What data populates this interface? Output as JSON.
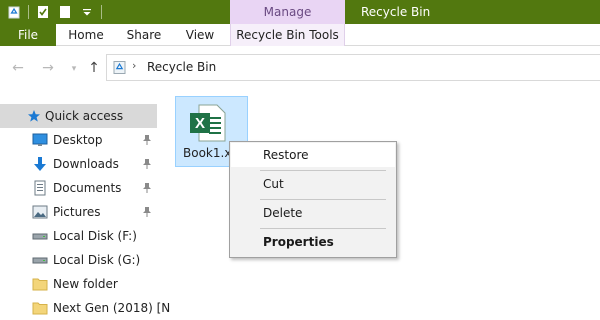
{
  "window": {
    "title": "Recycle Bin",
    "context_group": "Manage"
  },
  "ribbon": {
    "tabs": [
      "File",
      "Home",
      "Share",
      "View",
      "Recycle Bin Tools"
    ]
  },
  "address": {
    "location": "Recycle Bin",
    "separator": "›"
  },
  "nav": {
    "back_glyph": "←",
    "forward_glyph": "→",
    "recent_glyph": "▾",
    "up_glyph": "↑"
  },
  "nav_pane": {
    "items": [
      {
        "label": "Quick access",
        "icon": "star-icon"
      },
      {
        "label": "Desktop",
        "icon": "desktop-icon",
        "pinned": true
      },
      {
        "label": "Downloads",
        "icon": "download-icon",
        "pinned": true
      },
      {
        "label": "Documents",
        "icon": "documents-icon",
        "pinned": true
      },
      {
        "label": "Pictures",
        "icon": "pictures-icon",
        "pinned": true
      },
      {
        "label": "Local Disk (F:)",
        "icon": "drive-icon"
      },
      {
        "label": "Local Disk (G:)",
        "icon": "drive-icon"
      },
      {
        "label": "New folder",
        "icon": "folder-icon"
      },
      {
        "label": "Next Gen (2018) [N",
        "icon": "folder-icon"
      }
    ]
  },
  "files": [
    {
      "name": "Book1.xl",
      "icon": "excel-file-icon",
      "badge_letter": "X"
    }
  ],
  "context_menu": {
    "items": [
      "Restore",
      "Cut",
      "Delete",
      "Properties"
    ]
  },
  "colors": {
    "title_bar": "#52780f",
    "context_tab": "#e9d5f4",
    "selection": "#cce8ff",
    "excel_green": "#1f7246",
    "quick_access_blue": "#1a79d3"
  }
}
